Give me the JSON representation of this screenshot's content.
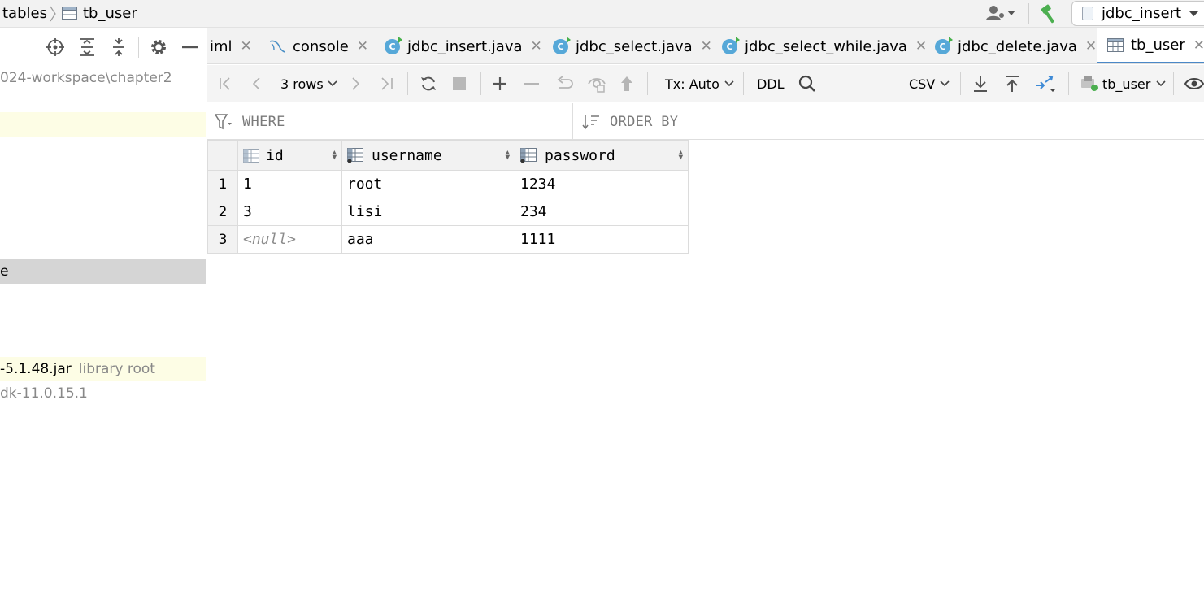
{
  "navbar": {
    "breadcrumb": [
      "tables",
      "tb_user"
    ],
    "run_config": "jdbc_insert"
  },
  "project_panel": {
    "rows": [
      {
        "text": "024-workspace\\chapter2",
        "secondary": "",
        "style": "gray"
      },
      {
        "text": "",
        "secondary": "",
        "style": "yellow"
      },
      {
        "text": "e",
        "secondary": "",
        "style": "selected"
      },
      {
        "text": "-5.1.48.jar",
        "secondary": "library root",
        "style": "yellow"
      },
      {
        "text": "dk-11.0.15.1",
        "secondary": "",
        "style": "gray"
      }
    ]
  },
  "tabs": [
    {
      "label": "iml",
      "icon": "",
      "active": false
    },
    {
      "label": "console",
      "icon": "mysql-console-icon",
      "active": false
    },
    {
      "label": "jdbc_insert.java",
      "icon": "java-class-icon",
      "active": false
    },
    {
      "label": "jdbc_select.java",
      "icon": "java-class-icon",
      "active": false
    },
    {
      "label": "jdbc_select_while.java",
      "icon": "java-class-icon",
      "active": false
    },
    {
      "label": "jdbc_delete.java",
      "icon": "java-class-icon",
      "active": false
    },
    {
      "label": "tb_user",
      "icon": "table-icon",
      "active": true
    }
  ],
  "grid_toolbar": {
    "rows_label": "3 rows",
    "tx_label": "Tx: Auto",
    "ddl_label": "DDL",
    "export_format": "CSV",
    "table_selector": "tb_user"
  },
  "filters": {
    "where_label": "WHERE",
    "order_by_label": "ORDER BY"
  },
  "table": {
    "columns": [
      "id",
      "username",
      "password"
    ],
    "rows": [
      {
        "num": "1",
        "id": "1",
        "username": "root",
        "password": "1234"
      },
      {
        "num": "2",
        "id": "3",
        "username": "lisi",
        "password": "234"
      },
      {
        "num": "3",
        "id": "<null>",
        "username": "aaa",
        "password": "1111"
      }
    ]
  },
  "colors": {
    "accent": "#4a88c7",
    "java_icon": "#56a8d8",
    "selection_gray": "#d5d5d5",
    "highlight_yellow": "#fdfde5",
    "build_green": "#4caf50"
  }
}
